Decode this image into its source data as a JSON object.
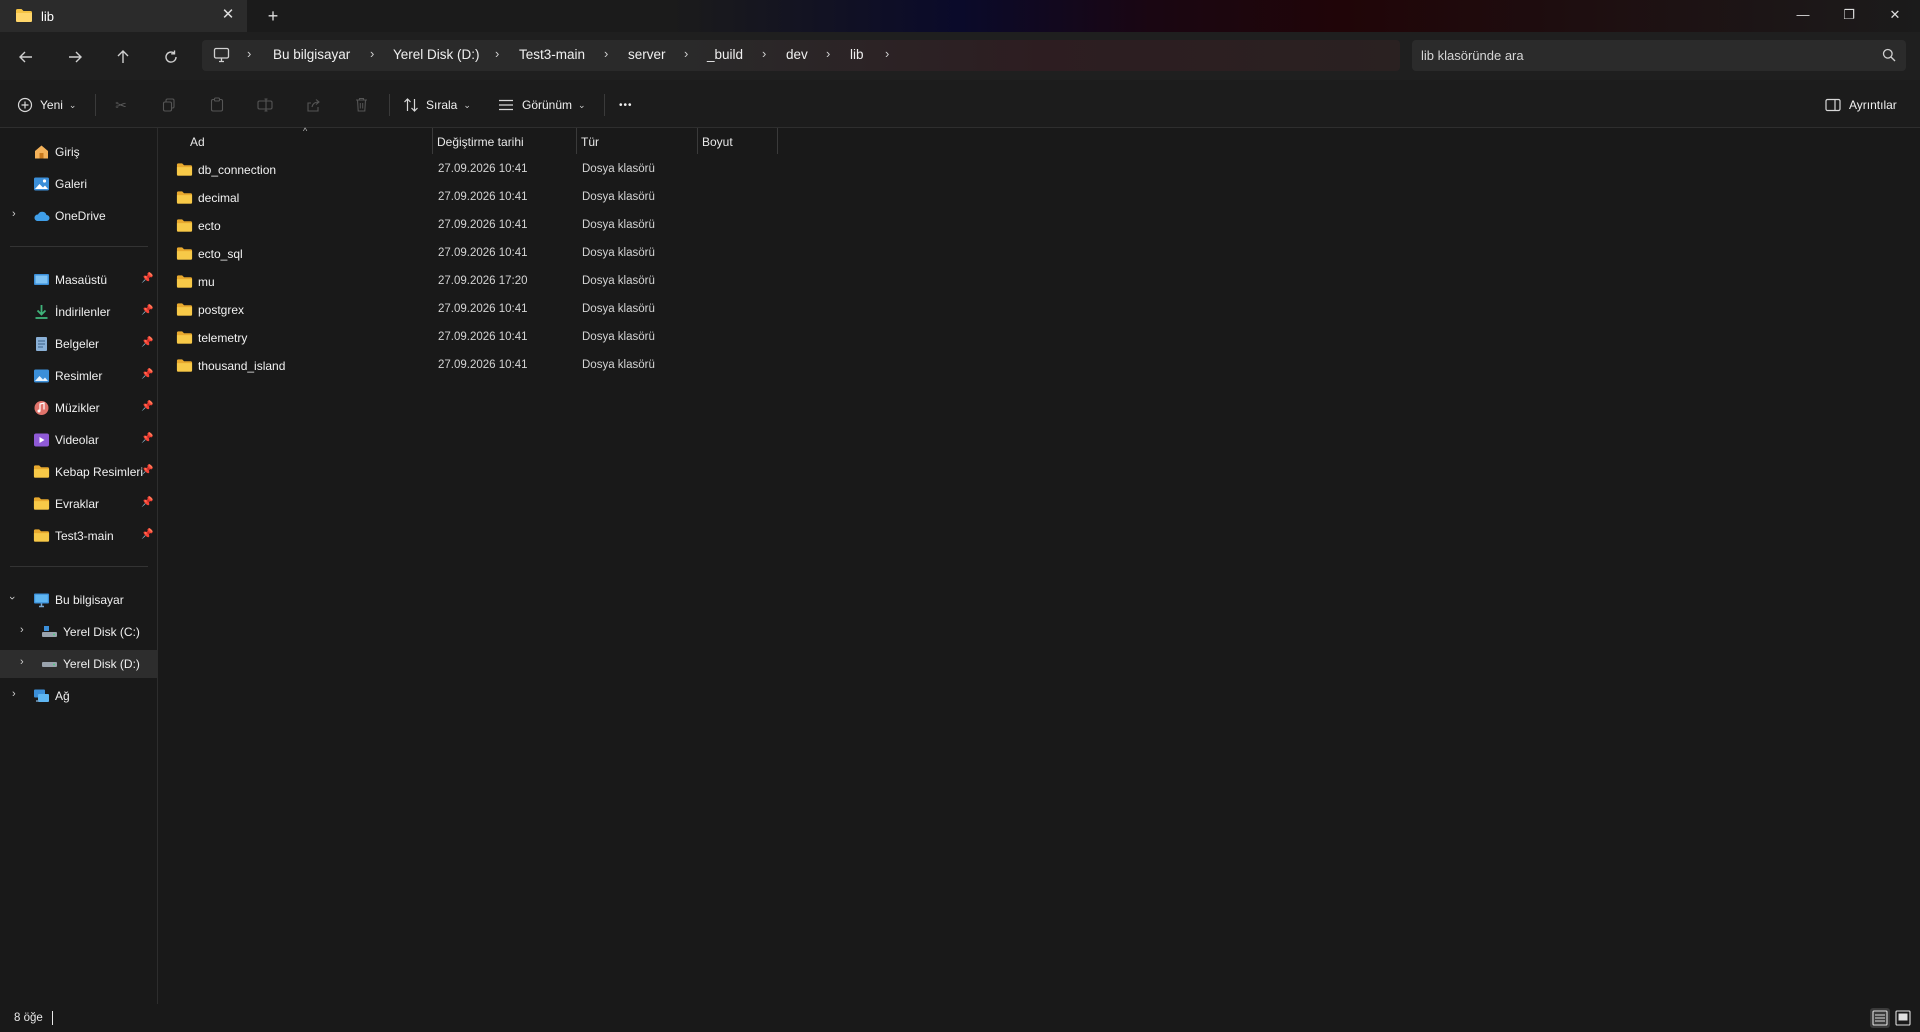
{
  "window": {
    "tab_title": "lib",
    "new_tab_symbol": "+",
    "close_tab_symbol": "✕",
    "minimize_symbol": "—",
    "restore_symbol": "❐",
    "close_symbol": "✕"
  },
  "breadcrumb": {
    "items": [
      "Bu bilgisayar",
      "Yerel Disk (D:)",
      "Test3-main",
      "server",
      "_build",
      "dev",
      "lib"
    ]
  },
  "search": {
    "placeholder": "lib klasöründe ara"
  },
  "commandbar": {
    "new_label": "Yeni",
    "sort_label": "Sırala",
    "view_label": "Görünüm",
    "more_symbol": "•••",
    "details_label": "Ayrıntılar"
  },
  "sidebar": {
    "top": [
      {
        "label": "Giriş",
        "icon": "home-icon"
      },
      {
        "label": "Galeri",
        "icon": "gallery-icon"
      },
      {
        "label": "OneDrive",
        "icon": "cloud-icon"
      }
    ],
    "pinned": [
      {
        "label": "Masaüstü",
        "icon": "desktop-icon"
      },
      {
        "label": "İndirilenler",
        "icon": "download-icon"
      },
      {
        "label": "Belgeler",
        "icon": "documents-icon"
      },
      {
        "label": "Resimler",
        "icon": "pictures-icon"
      },
      {
        "label": "Müzikler",
        "icon": "music-icon"
      },
      {
        "label": "Videolar",
        "icon": "videos-icon"
      },
      {
        "label": "Kebap Resimleri",
        "icon": "folder-icon"
      },
      {
        "label": "Evraklar",
        "icon": "folder-icon"
      },
      {
        "label": "Test3-main",
        "icon": "folder-icon"
      }
    ],
    "computer": [
      {
        "label": "Bu bilgisayar",
        "icon": "computer-icon"
      },
      {
        "label": "Yerel Disk (C:)",
        "icon": "drive-c-icon"
      },
      {
        "label": "Yerel Disk (D:)",
        "icon": "drive-d-icon"
      },
      {
        "label": "Ağ",
        "icon": "network-icon"
      }
    ]
  },
  "columns": {
    "name": "Ad",
    "date": "Değiştirme tarihi",
    "type": "Tür",
    "size": "Boyut"
  },
  "files": [
    {
      "name": "db_connection",
      "date": "27.09.2026 10:41",
      "type": "Dosya klasörü"
    },
    {
      "name": "decimal",
      "date": "27.09.2026 10:41",
      "type": "Dosya klasörü"
    },
    {
      "name": "ecto",
      "date": "27.09.2026 10:41",
      "type": "Dosya klasörü"
    },
    {
      "name": "ecto_sql",
      "date": "27.09.2026 10:41",
      "type": "Dosya klasörü"
    },
    {
      "name": "mu",
      "date": "27.09.2026 17:20",
      "type": "Dosya klasörü"
    },
    {
      "name": "postgrex",
      "date": "27.09.2026 10:41",
      "type": "Dosya klasörü"
    },
    {
      "name": "telemetry",
      "date": "27.09.2026 10:41",
      "type": "Dosya klasörü"
    },
    {
      "name": "thousand_island",
      "date": "27.09.2026 10:41",
      "type": "Dosya klasörü"
    }
  ],
  "status": {
    "item_count": "8 öğe"
  },
  "colors": {
    "folder": "#f5c344",
    "background": "#191919",
    "selected": "#2d2d2d"
  }
}
